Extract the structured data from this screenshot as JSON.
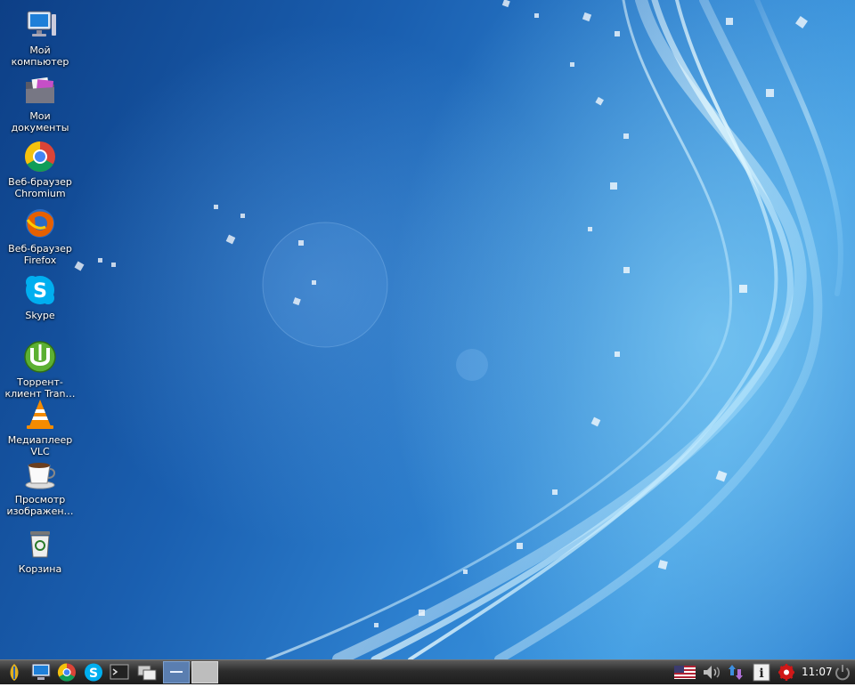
{
  "desktop": {
    "icons": [
      {
        "label_1": "Мой",
        "label_2": "компьютер",
        "icon": "computer-icon"
      },
      {
        "label_1": "Мои",
        "label_2": "документы",
        "icon": "documents-folder-icon"
      },
      {
        "label_1": "Веб-браузер",
        "label_2": "Chromium",
        "icon": "chromium-icon"
      },
      {
        "label_1": "Веб-браузер",
        "label_2": "Firefox",
        "icon": "firefox-icon"
      },
      {
        "label_1": "Skype",
        "label_2": "",
        "icon": "skype-icon"
      },
      {
        "label_1": "Торрент-",
        "label_2": "клиент Tran…",
        "icon": "utorrent-icon"
      },
      {
        "label_1": "Медиаплеер",
        "label_2": "VLC",
        "icon": "vlc-cone-icon"
      },
      {
        "label_1": "Просмотр",
        "label_2": "изображен…",
        "icon": "image-viewer-cup-icon"
      },
      {
        "label_1": "Корзина",
        "label_2": "",
        "icon": "trash-icon"
      }
    ]
  },
  "taskbar": {
    "clock": "11:07",
    "launchers": [
      "start-menu-icon",
      "computer-icon",
      "chromium-icon",
      "skype-icon",
      "terminal-icon",
      "windows-switcher-icon"
    ],
    "tray": [
      "us-flag-icon",
      "volume-icon",
      "network-icon",
      "info-icon",
      "update-notifier-icon",
      "power-icon"
    ]
  },
  "colors": {
    "taskbar": "#2c2c2c",
    "desktop_blue": "#1a5fb0",
    "highlight": "#bfeaff"
  }
}
